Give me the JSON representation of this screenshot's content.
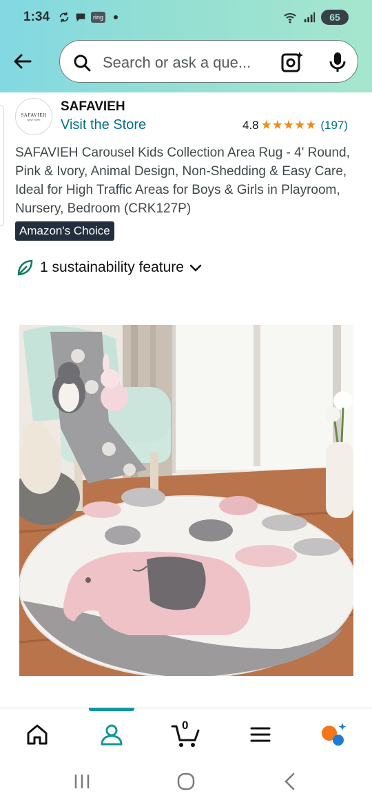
{
  "status_bar": {
    "time": "1:34",
    "ring_label": "ring",
    "battery": "65"
  },
  "search": {
    "placeholder": "Search or ask a que..."
  },
  "product": {
    "brand_logo_text": "SAFAVIEH",
    "brand_logo_sub": "NEW YORK",
    "brand_name": "SAFAVIEH",
    "visit_store": "Visit the Store",
    "rating_value": "4.8",
    "rating_stars": 5,
    "rating_count": "(197)",
    "title": "SAFAVIEH Carousel Kids Collection Area Rug - 4' Round, Pink & Ivory, Animal Design, Non-Shedding & Easy Care, Ideal for High Traffic Areas for Boys & Girls in Playroom, Nursery, Bedroom (CRK127P)",
    "badge": "Amazon's Choice",
    "sustainability": "1 sustainability feature"
  },
  "bottom_nav": {
    "items": [
      {
        "name": "home",
        "icon": "home-icon"
      },
      {
        "name": "account",
        "icon": "person-icon",
        "active": true
      },
      {
        "name": "cart",
        "icon": "cart-icon",
        "count": "0"
      },
      {
        "name": "menu",
        "icon": "hamburger-icon"
      },
      {
        "name": "rufus",
        "icon": "ai-assistant-icon"
      }
    ]
  },
  "colors": {
    "link": "#007185",
    "star": "#f08a1a",
    "badge_bg": "#232f3e",
    "nav_active": "#11969e",
    "header_start": "#82d8e3",
    "header_end": "#a6e6cf"
  }
}
